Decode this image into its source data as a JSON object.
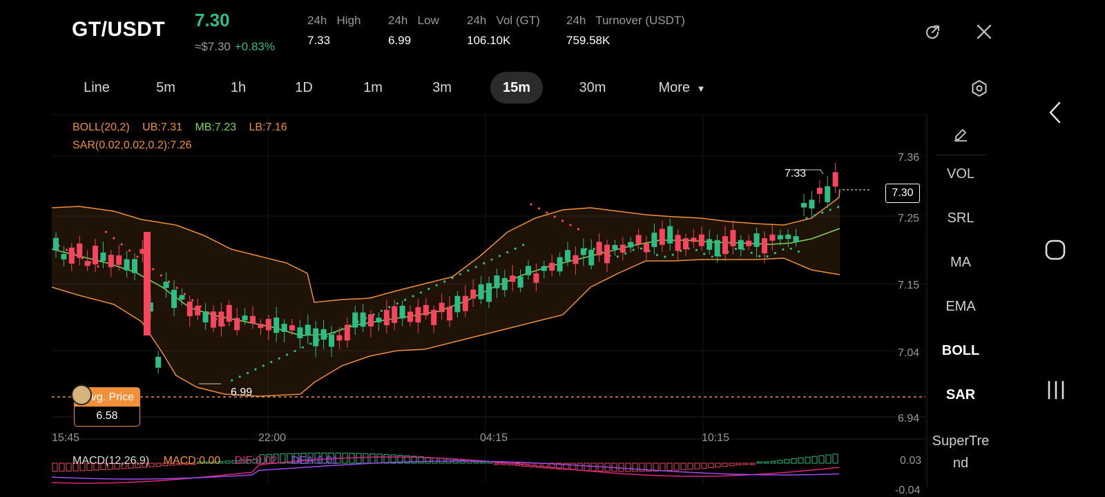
{
  "header": {
    "pair": "GT/USDT",
    "last_price": "7.30",
    "approx": "≈$7.30",
    "change_pct": "+0.83%",
    "stats": [
      {
        "label": "24h   High",
        "value": "7.33"
      },
      {
        "label": "24h   Low",
        "value": "6.99"
      },
      {
        "label": "24h   Vol (GT)",
        "value": "106.10K"
      },
      {
        "label": "24h   Turnover (USDT)",
        "value": "759.58K"
      }
    ],
    "share_icon": "share-icon",
    "close_icon": "close-icon"
  },
  "timeframes": {
    "items": [
      "Line",
      "5m",
      "1h",
      "1D",
      "1m",
      "3m",
      "15m",
      "30m",
      "More"
    ],
    "active": "15m",
    "settings_icon": "hexagon-settings-icon"
  },
  "indicators": {
    "boll": {
      "name": "BOLL(20,2)",
      "ub": "UB:7.31",
      "mb": "MB:7.23",
      "lb": "LB:7.16"
    },
    "sar": {
      "label": "SAR(0.02,0.02,0.2):7.26"
    },
    "macd": {
      "name": "MACD(12,26,9)",
      "macd": "MACD:0.00",
      "dif": "DIF:0.02",
      "dea": "DEA:0.01"
    }
  },
  "chart": {
    "price_axis": [
      "7.36",
      "7.25",
      "7.15",
      "7.04",
      "6.94"
    ],
    "time_axis": [
      "15:45",
      "22:00",
      "04:15",
      "10:15"
    ],
    "high_label": "7.33",
    "low_label": "6.99",
    "current_price": "7.30",
    "avg_price_label": "Avg. Price",
    "avg_price": "6.58",
    "macd_axis": [
      "0.03",
      "-0.04"
    ],
    "colors": {
      "up": "#2ebd85",
      "down": "#f6465d",
      "boll_band": "#f0903a",
      "mid": "#7ed957",
      "dif": "#e2247f",
      "dea": "#9a4df0"
    }
  },
  "sidebar": {
    "edit_icon": "pencil-icon",
    "items": [
      "VOL",
      "SRL",
      "MA",
      "EMA",
      "BOLL",
      "SAR",
      "SuperTrend"
    ],
    "active": [
      "BOLL",
      "SAR"
    ]
  },
  "android_nav": {
    "back": "back-icon",
    "home": "home-icon",
    "recents": "recents-icon"
  }
}
